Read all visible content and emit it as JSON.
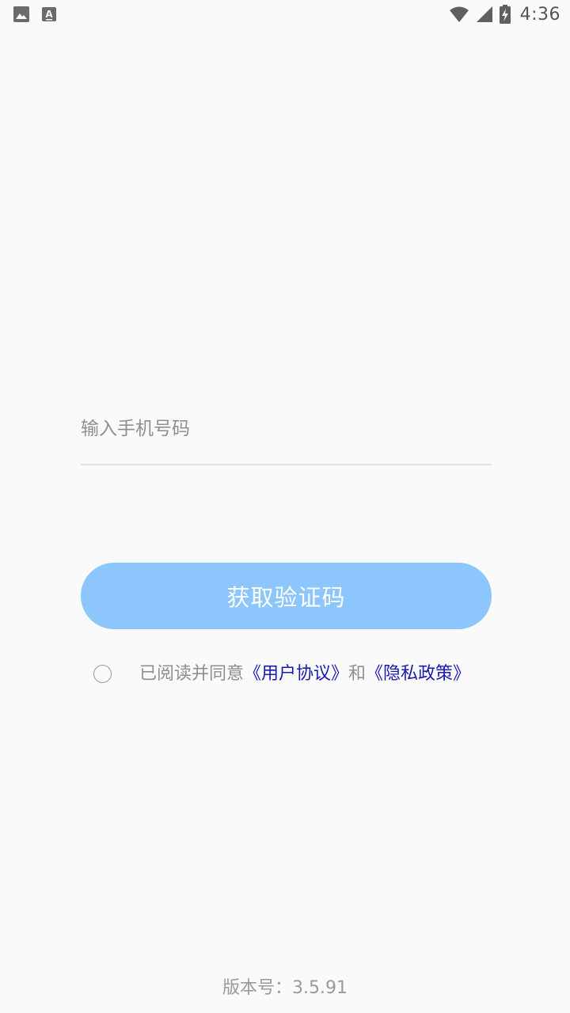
{
  "status_bar": {
    "time": "4:36",
    "left_icons": [
      "image-icon",
      "text-a-icon"
    ],
    "right_icons": [
      "wifi-icon",
      "cell-signal-icon",
      "battery-charging-icon"
    ]
  },
  "login": {
    "phone_placeholder": "输入手机号码",
    "phone_value": "",
    "get_code_label": "获取验证码",
    "get_code_color": "#8cc6fd"
  },
  "agreement": {
    "prefix": "已阅读并同意",
    "user_agreement": "《用户协议》",
    "conjunction": "和",
    "privacy_policy": "《隐私政策》",
    "link_color": "#1a1ab0",
    "checked": false
  },
  "footer": {
    "version": "版本号：3.5.91"
  }
}
